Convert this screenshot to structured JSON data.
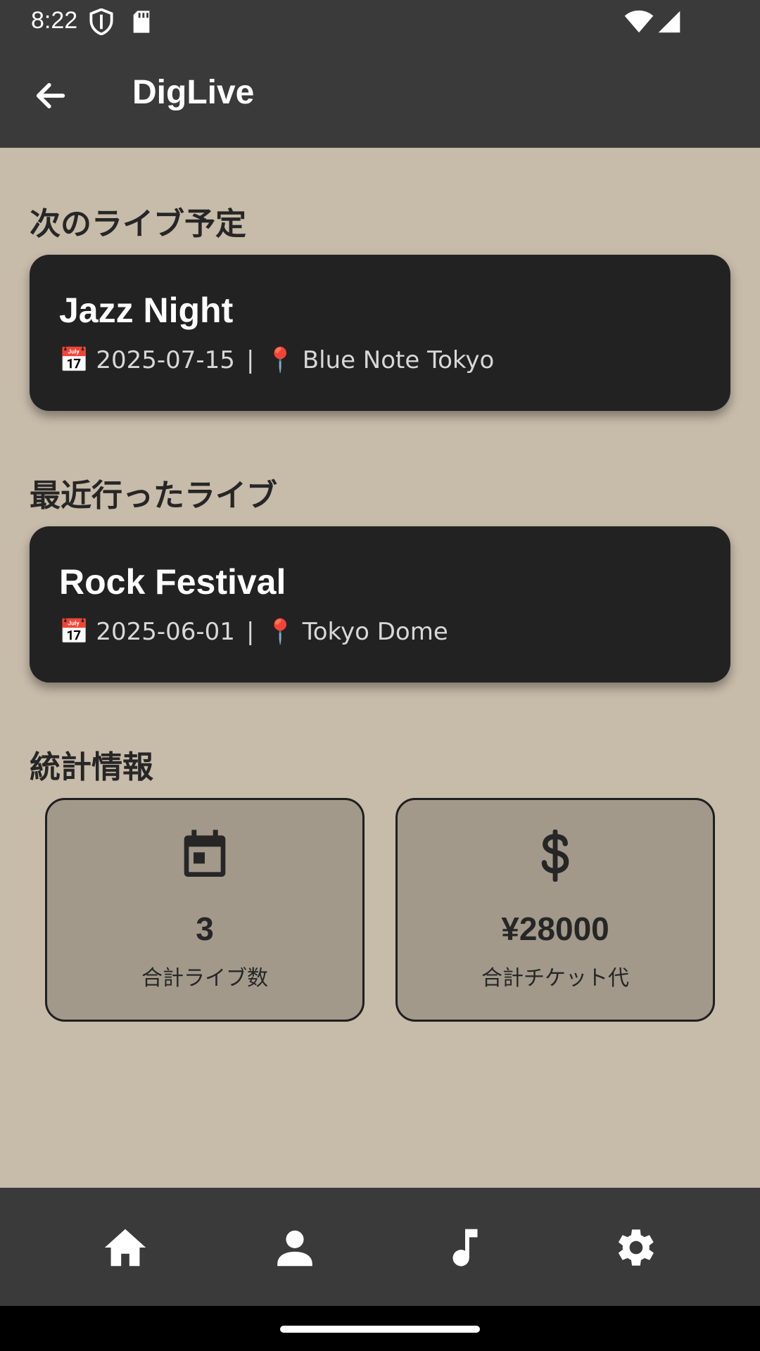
{
  "status_bar": {
    "time": "8:22",
    "icons": [
      "shield-icon",
      "sd-card-icon",
      "wifi-icon",
      "signal-icon"
    ]
  },
  "app_bar": {
    "title": "DigLive",
    "back_icon": "arrow-left-icon"
  },
  "upcoming": {
    "section_title": "次のライブ予定",
    "event": {
      "name": "Jazz Night",
      "date_icon": "📅",
      "date": "2025-07-15",
      "separator": "|",
      "venue_icon": "📍",
      "venue": "Blue Note Tokyo"
    }
  },
  "recent": {
    "section_title": "最近行ったライブ",
    "event": {
      "name": "Rock Festival",
      "date_icon": "📅",
      "date": "2025-06-01",
      "separator": "|",
      "venue_icon": "📍",
      "venue": "Tokyo Dome"
    }
  },
  "stats": {
    "section_title": "統計情報",
    "items": [
      {
        "icon": "calendar-icon",
        "value": "3",
        "label": "合計ライブ数"
      },
      {
        "icon": "dollar-icon",
        "value": "¥28000",
        "label": "合計チケット代"
      }
    ]
  },
  "bottom_nav": {
    "items": [
      "home-icon",
      "person-icon",
      "music-note-icon",
      "settings-icon"
    ]
  },
  "colors": {
    "background": "#c7bba9",
    "bar": "#3a3a3a",
    "card": "#222222",
    "stat_card": "#a3998b"
  }
}
